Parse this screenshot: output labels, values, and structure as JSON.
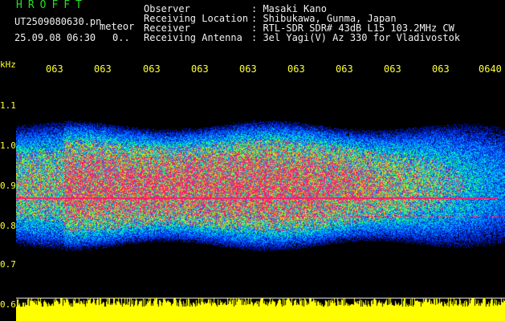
{
  "header": {
    "logo": "HROFFT",
    "filename": "UT2509080630.pn",
    "meteor_tag": "meteor",
    "datetime": "25.09.08 06:30",
    "counter": "0..",
    "rows": [
      {
        "label": "Observer",
        "value": ": Masaki Kano"
      },
      {
        "label": "Receiving Location",
        "value": ": Shibukawa, Gunma, Japan"
      },
      {
        "label": "Receiver",
        "value": ": RTL-SDR SDR# 43dB L15 103.2MHz CW"
      },
      {
        "label": "Receiving Antenna",
        "value": ": 3el Yagi(V) Az 330 for Vladivostok"
      }
    ]
  },
  "axis": {
    "unit": "kHz",
    "x_ticks": [
      "063",
      "063",
      "063",
      "063",
      "063",
      "063",
      "063",
      "063",
      "063",
      "0640"
    ],
    "y_ticks": [
      "1.1",
      "1.0",
      "0.9",
      "0.8",
      "0.7",
      "0.6"
    ]
  },
  "colors": {
    "background": "#000000",
    "text": "#f0f0f0",
    "tick_label": "#ffff33",
    "logo": "#22e022",
    "echo": "#ff1a6e",
    "baseline": "#ffff00"
  }
}
